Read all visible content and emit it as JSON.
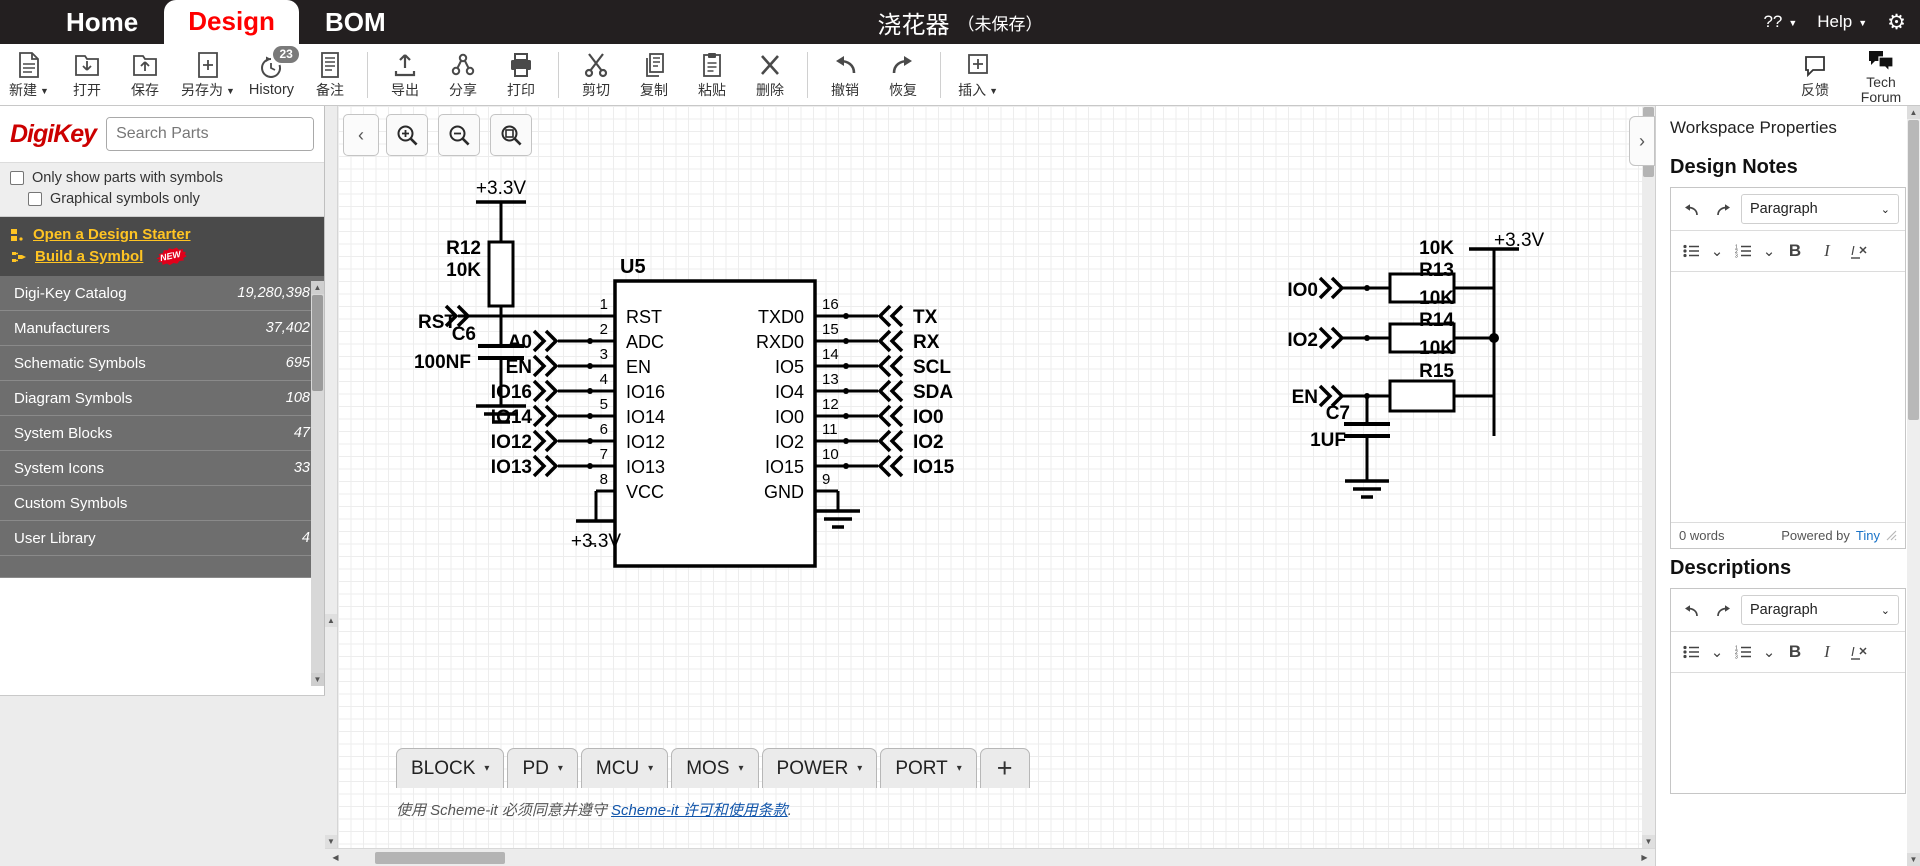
{
  "topbar": {
    "tabs": [
      {
        "label": "Home",
        "active": false
      },
      {
        "label": "Design",
        "active": true
      },
      {
        "label": "BOM",
        "active": false
      }
    ],
    "doc_title": "浇花器",
    "doc_state": "（未保存）",
    "language_label": "??",
    "help_label": "Help",
    "settings_icon": "gear-icon"
  },
  "ribbon": {
    "group1": [
      {
        "label": "新建",
        "icon": "new-document-icon",
        "caret": true
      },
      {
        "label": "打开",
        "icon": "folder-open-icon",
        "caret": false
      },
      {
        "label": "保存",
        "icon": "folder-save-icon",
        "caret": false
      },
      {
        "label": "另存为",
        "icon": "save-as-icon",
        "caret": true
      },
      {
        "label": "History",
        "icon": "history-icon",
        "caret": false,
        "badge": "23"
      },
      {
        "label": "备注",
        "icon": "notes-icon",
        "caret": false
      }
    ],
    "group2": [
      {
        "label": "导出",
        "icon": "export-icon",
        "caret": false
      },
      {
        "label": "分享",
        "icon": "share-icon",
        "caret": false
      },
      {
        "label": "打印",
        "icon": "print-icon",
        "caret": false
      }
    ],
    "group3": [
      {
        "label": "剪切",
        "icon": "scissors-icon",
        "caret": false
      },
      {
        "label": "复制",
        "icon": "copy-icon",
        "caret": false
      },
      {
        "label": "粘贴",
        "icon": "paste-icon",
        "caret": false
      },
      {
        "label": "删除",
        "icon": "delete-x-icon",
        "caret": false
      }
    ],
    "group4": [
      {
        "label": "撤销",
        "icon": "undo-arrow-icon",
        "caret": false
      },
      {
        "label": "恢复",
        "icon": "redo-arrow-icon",
        "caret": false
      }
    ],
    "group5": [
      {
        "label": "插入",
        "icon": "insert-plus-icon",
        "caret": true
      }
    ],
    "right": [
      {
        "label": "反馈",
        "icon": "feedback-bubble-icon"
      },
      {
        "label": "Tech",
        "label2": "Forum",
        "icon": "tech-forum-icon"
      }
    ]
  },
  "left_panel": {
    "brand": "DigiKey",
    "search_placeholder": "Search Parts",
    "search_value": "",
    "search_icon": "search-icon",
    "filters": [
      {
        "label": "Only show parts with symbols",
        "checked": false
      },
      {
        "label": "Graphical symbols only",
        "checked": false
      }
    ],
    "links": [
      {
        "label": "Open a Design Starter",
        "icon": "design-starter-icon",
        "badge": ""
      },
      {
        "label": "Build a Symbol",
        "icon": "build-symbol-icon",
        "badge": "NEW"
      }
    ],
    "catalog": [
      {
        "label": "Digi-Key Catalog",
        "count": "19,280,398"
      },
      {
        "label": "Manufacturers",
        "count": "37,402"
      },
      {
        "label": "Schematic Symbols",
        "count": "695"
      },
      {
        "label": "Diagram Symbols",
        "count": "108"
      },
      {
        "label": "System Blocks",
        "count": "47"
      },
      {
        "label": "System Icons",
        "count": "33"
      },
      {
        "label": "Custom Symbols",
        "count": ""
      },
      {
        "label": "User Library",
        "count": "4"
      }
    ]
  },
  "canvas": {
    "collapse_left_icon": "chevron-left-icon",
    "collapse_right_icon": "chevron-right-icon",
    "zoom_tools": [
      {
        "name": "zoom-in",
        "icon": "zoom-in-icon"
      },
      {
        "name": "zoom-out",
        "icon": "zoom-out-icon"
      },
      {
        "name": "zoom-fit",
        "icon": "zoom-fit-icon"
      }
    ],
    "sheet_tabs": [
      {
        "label": "BLOCK"
      },
      {
        "label": "PD"
      },
      {
        "label": "MCU"
      },
      {
        "label": "MOS"
      },
      {
        "label": "POWER"
      },
      {
        "label": "PORT"
      }
    ],
    "add_sheet_label": "+",
    "footer_note_pre": "使用 Scheme-it 必须同意并遵守 ",
    "footer_note_link": "Scheme-it 许可和使用条款",
    "footer_note_post": "."
  },
  "schematic": {
    "ic": {
      "ref": "U5",
      "left_pins": [
        {
          "num": "1",
          "name": "RST",
          "net": "RST"
        },
        {
          "num": "2",
          "name": "ADC",
          "net": "A0"
        },
        {
          "num": "3",
          "name": "EN",
          "net": "EN"
        },
        {
          "num": "4",
          "name": "IO16",
          "net": "IO16"
        },
        {
          "num": "5",
          "name": "IO14",
          "net": "IO14"
        },
        {
          "num": "6",
          "name": "IO12",
          "net": "IO12"
        },
        {
          "num": "7",
          "name": "IO13",
          "net": "IO13"
        },
        {
          "num": "8",
          "name": "VCC",
          "net": ""
        }
      ],
      "right_pins": [
        {
          "num": "16",
          "name": "TXD0",
          "net": "TX"
        },
        {
          "num": "15",
          "name": "RXD0",
          "net": "RX"
        },
        {
          "num": "14",
          "name": "IO5",
          "net": "SCL"
        },
        {
          "num": "13",
          "name": "IO4",
          "net": "SDA"
        },
        {
          "num": "12",
          "name": "IO0",
          "net": "IO0"
        },
        {
          "num": "11",
          "name": "IO2",
          "net": "IO2"
        },
        {
          "num": "10",
          "name": "IO15",
          "net": "IO15"
        },
        {
          "num": "9",
          "name": "GND",
          "net": ""
        }
      ]
    },
    "components": [
      {
        "ref": "R12",
        "value": "10K",
        "type": "resistor"
      },
      {
        "ref": "C6",
        "value": "100NF",
        "type": "capacitor"
      },
      {
        "ref": "R13",
        "value": "10K",
        "type": "resistor"
      },
      {
        "ref": "R14",
        "value": "10K",
        "type": "resistor"
      },
      {
        "ref": "R15",
        "value": "10K",
        "type": "resistor"
      },
      {
        "ref": "C7",
        "value": "1UF",
        "type": "capacitor"
      }
    ],
    "power_labels": [
      "+3.3V",
      "+3.3V",
      "+3.3V"
    ],
    "vcc_bottom_label": "+3.3V",
    "right_nets": [
      "IO0",
      "IO2",
      "EN"
    ]
  },
  "right_panel": {
    "title": "Workspace Properties",
    "sections": [
      {
        "heading": "Design Notes",
        "paragraph_label": "Paragraph",
        "word_count": "0 words",
        "powered_by": "Powered by",
        "powered_by_link": "Tiny",
        "content": ""
      },
      {
        "heading": "Descriptions",
        "paragraph_label": "Paragraph",
        "word_count": "",
        "powered_by": "",
        "powered_by_link": "",
        "content": ""
      }
    ],
    "toolbar_buttons": [
      "undo-icon",
      "redo-icon",
      "bullet-list-icon",
      "numbered-list-icon",
      "bold-icon",
      "italic-icon",
      "clear-format-icon"
    ]
  },
  "colors": {
    "topbar_bg": "#231f20",
    "active_tab_text": "#ff0000",
    "brand_red": "#cc0000",
    "link_yellow": "#ffc423",
    "catalog_bg": "#6e6e6e",
    "dark_links_bg": "#4a4a4a"
  }
}
